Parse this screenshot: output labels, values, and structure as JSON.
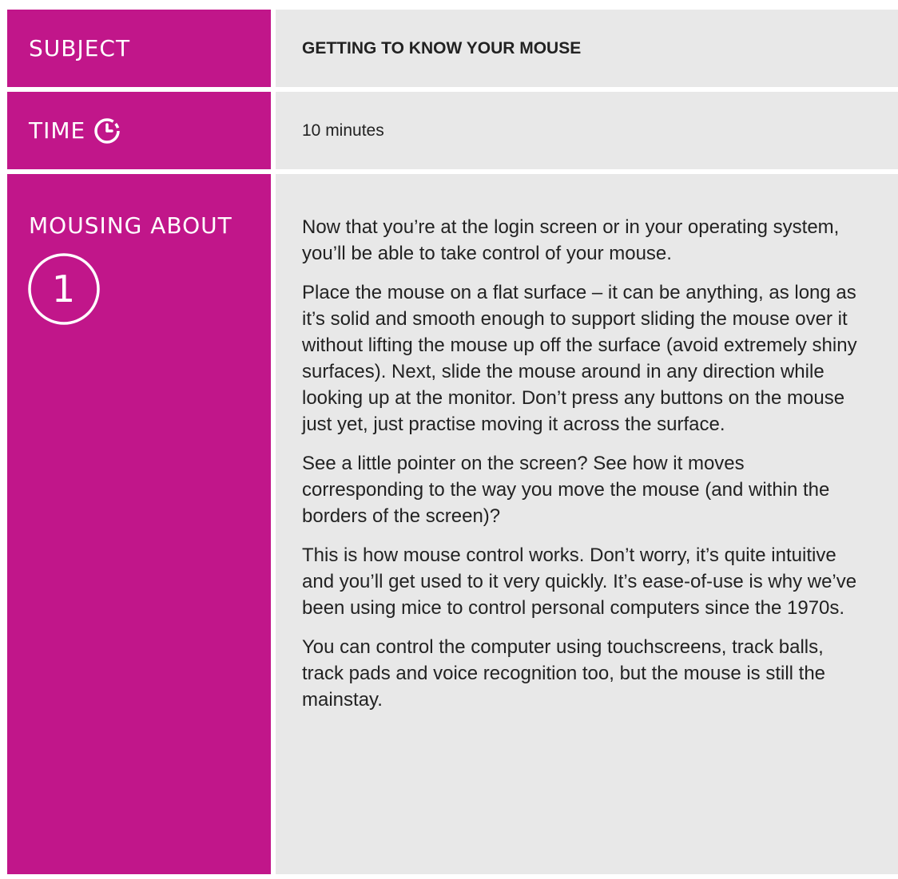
{
  "subject": {
    "label": "SUBJECT",
    "value": "GETTING TO KNOW YOUR MOUSE"
  },
  "time": {
    "label": "TIME",
    "value": "10 minutes",
    "icon": "clock-icon"
  },
  "mousing": {
    "label": "MOUSING ABOUT",
    "step_number": "1",
    "paragraphs": [
      "Now that you’re at the login screen or in your operating system, you’ll be able to take control of your mouse.",
      "Place the mouse on a flat surface – it can be anything, as long as it’s solid and smooth enough to support sliding the mouse over it without lifting the mouse up off the surface (avoid extremely shiny surfaces). Next, slide the mouse around in any direction while looking up at the monitor. Don’t press any buttons on the mouse just yet, just practise moving it across the surface.",
      "See a little pointer on the screen? See how it moves corresponding to the way you move the mouse (and within the borders of the screen)?",
      "This is how mouse control works. Don’t worry, it’s quite intuitive and you’ll get used to it very quickly. It’s ease-of-use is why we’ve been using mice to control personal computers since the 1970s.",
      "You can control the computer using touchscreens, track balls, track pads and voice recognition too, but the mouse is still the mainstay."
    ]
  },
  "colors": {
    "label_bg": "#c1168a",
    "content_bg": "#e8e8e8",
    "text": "#222222"
  }
}
